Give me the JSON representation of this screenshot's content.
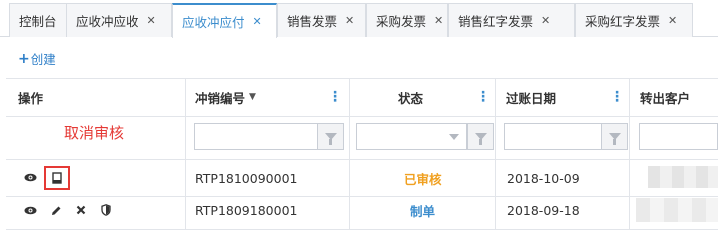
{
  "tabs": [
    {
      "label": "控制台",
      "closable": false,
      "active": false
    },
    {
      "label": "应收冲应收",
      "closable": true,
      "active": false
    },
    {
      "label": "应收冲应付",
      "closable": true,
      "active": true
    },
    {
      "label": "销售发票",
      "closable": true,
      "active": false
    },
    {
      "label": "采购发票",
      "closable": true,
      "active": false
    },
    {
      "label": "销售红字发票",
      "closable": true,
      "active": false
    },
    {
      "label": "采购红字发票",
      "closable": true,
      "active": false
    }
  ],
  "toolbar": {
    "create_label": "创建",
    "plus": "+"
  },
  "annotation": {
    "text": "取消审核"
  },
  "grid": {
    "columns": {
      "actions": "操作",
      "code": "冲销编号",
      "status": "状态",
      "date": "过账日期",
      "customer": "转出客户"
    },
    "rows": [
      {
        "code": "RTP1810090001",
        "status": "已审核",
        "status_color": "#f0a020",
        "date": "2018-10-09",
        "actions": [
          "eye-icon",
          "document-icon"
        ]
      },
      {
        "code": "RTP1809180001",
        "status": "制单",
        "status_color": "#3c8dcd",
        "date": "2018-09-18",
        "actions": [
          "eye-icon",
          "pencil-icon",
          "close-icon",
          "shield-icon"
        ]
      }
    ]
  },
  "colors": {
    "accent": "#3c8dcd",
    "annotation": "#e53935",
    "approved": "#f0a020"
  }
}
